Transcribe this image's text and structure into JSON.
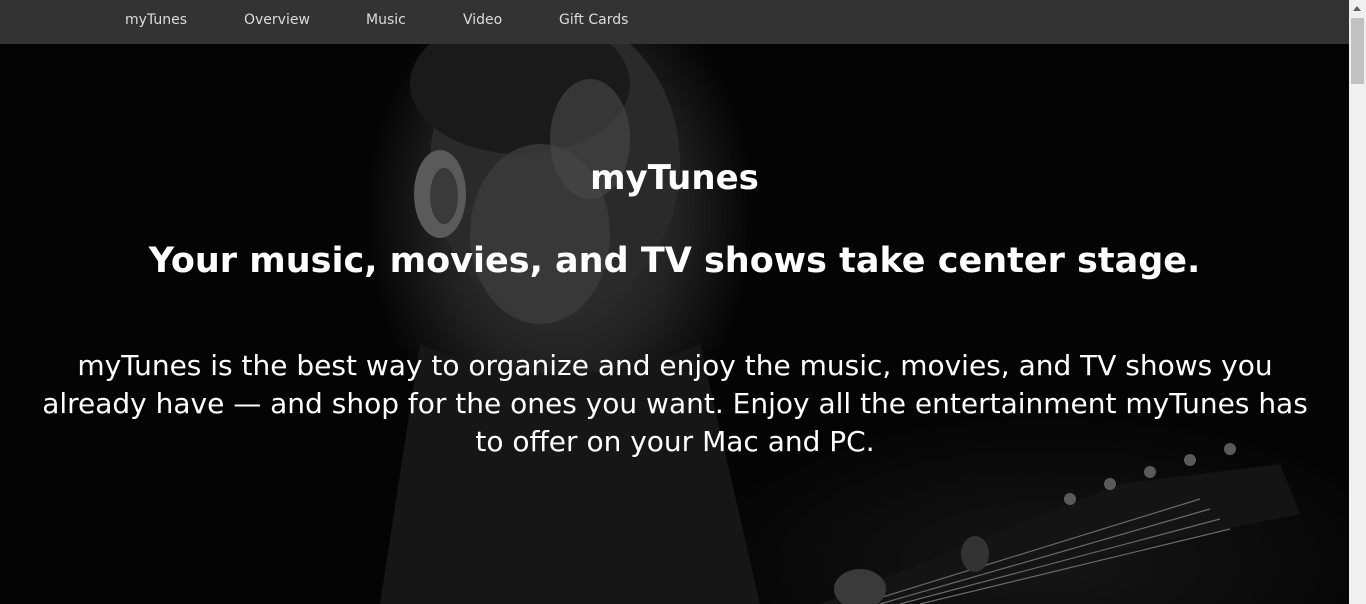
{
  "nav": {
    "items": [
      {
        "label": "myTunes"
      },
      {
        "label": "Overview"
      },
      {
        "label": "Music"
      },
      {
        "label": "Video"
      },
      {
        "label": "Gift Cards"
      }
    ]
  },
  "hero": {
    "title": "myTunes",
    "subtitle": "Your music, movies, and TV shows take center stage.",
    "body": "myTunes is the best way to organize and enjoy the music, movies, and TV shows you already have — and shop for the ones you want. Enjoy all the entertainment myTunes has to offer on your Mac and PC."
  },
  "colors": {
    "navbar_bg": "#333333",
    "nav_text": "#dcdcdc",
    "hero_text": "#ffffff",
    "hero_bg": "#000000"
  },
  "icons": {
    "scroll_up": "scroll-up-arrow-icon"
  }
}
